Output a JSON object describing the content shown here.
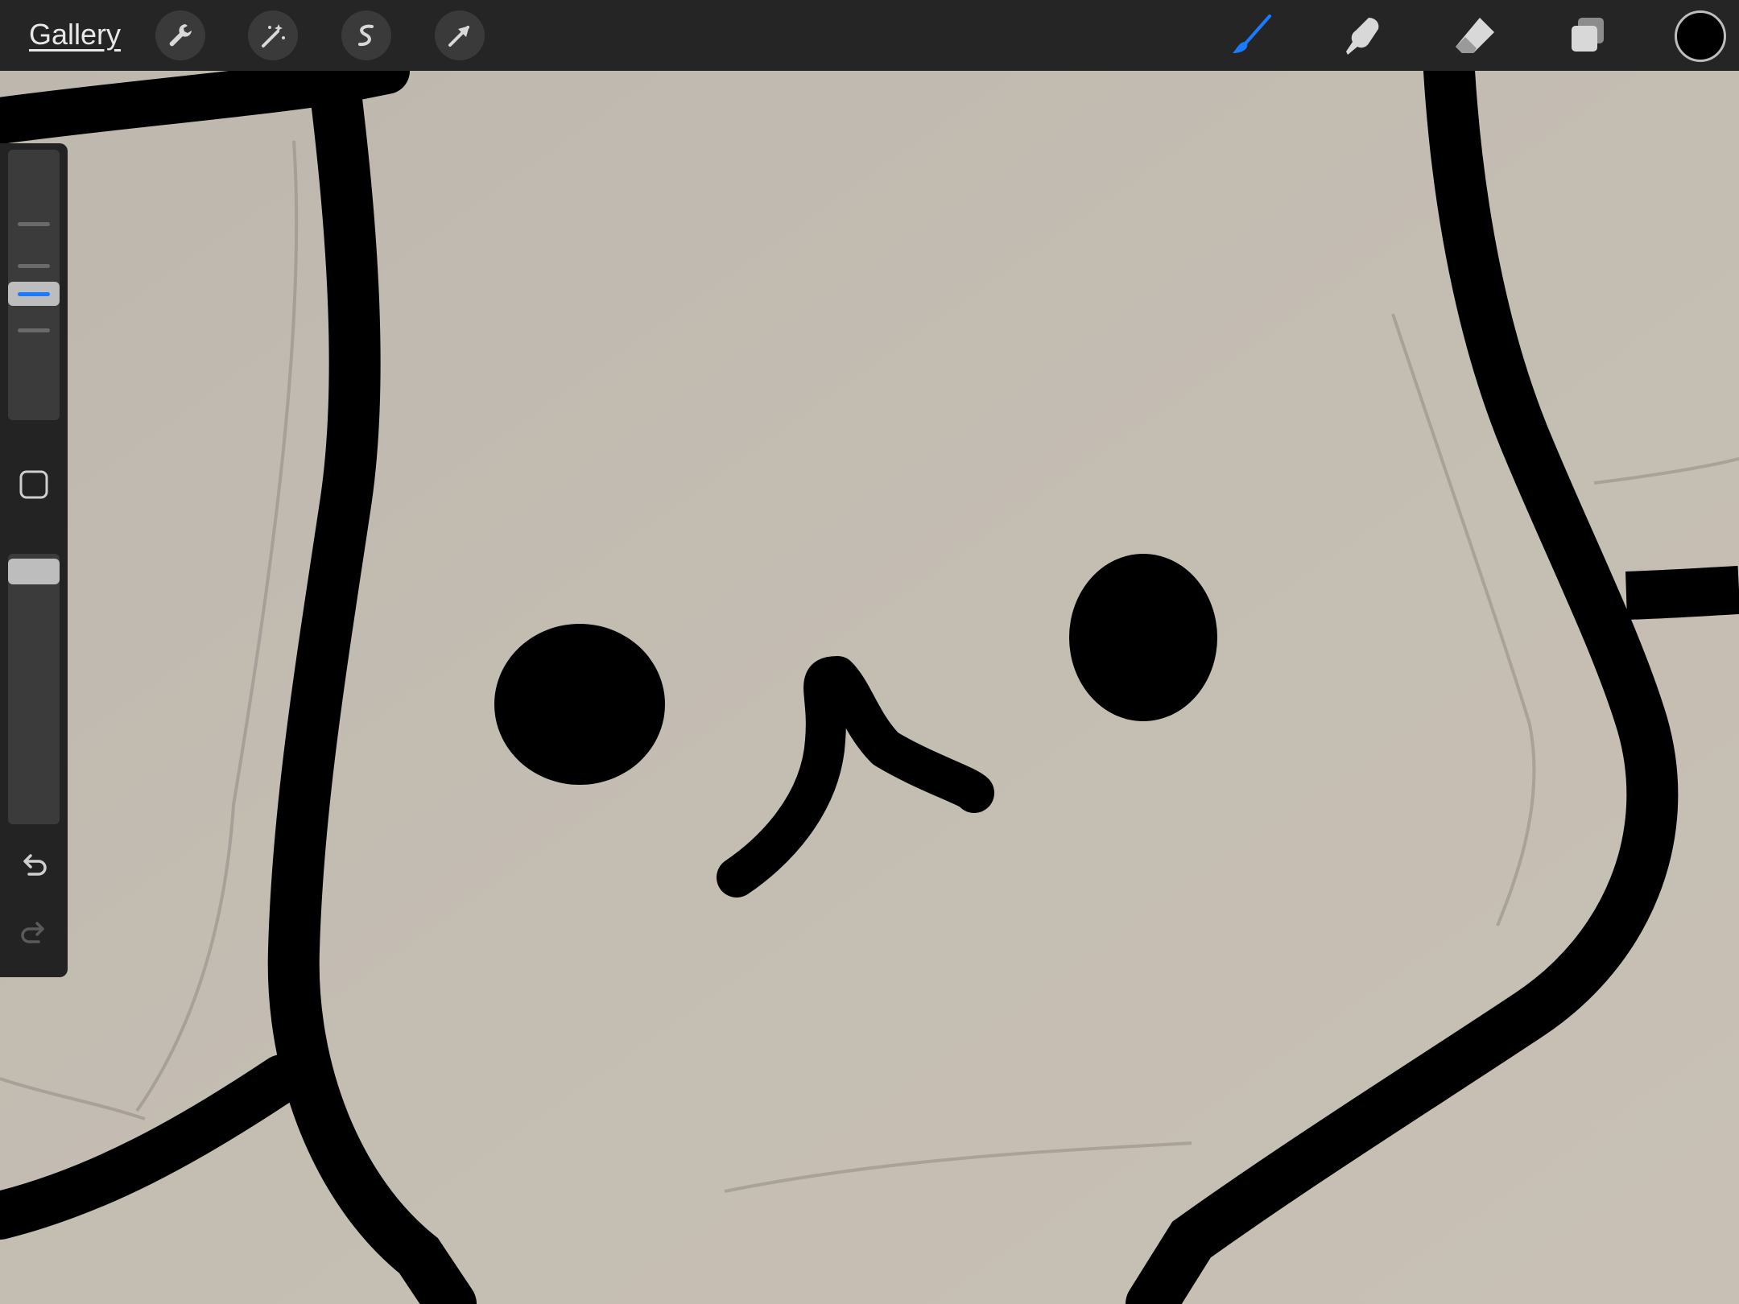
{
  "topbar": {
    "gallery_label": "Gallery",
    "left_tools": [
      {
        "name": "actions",
        "icon": "wrench-icon"
      },
      {
        "name": "adjustments",
        "icon": "magic-wand-icon"
      },
      {
        "name": "selection",
        "icon": "selection-s-icon"
      },
      {
        "name": "transform",
        "icon": "arrow-cursor-icon"
      }
    ],
    "right_tools": [
      {
        "name": "brush",
        "icon": "paintbrush-icon",
        "active": true
      },
      {
        "name": "smudge",
        "icon": "smudge-finger-icon",
        "active": false
      },
      {
        "name": "eraser",
        "icon": "eraser-icon",
        "active": false
      },
      {
        "name": "layers",
        "icon": "layers-icon",
        "active": false
      }
    ],
    "current_color": "#000000"
  },
  "sidebar": {
    "brush_size_level": 0.3,
    "opacity_level": 1.0,
    "icons": [
      "modify-square-icon",
      "undo-icon",
      "redo-icon"
    ]
  },
  "colors": {
    "accent": "#1a7bff",
    "toolbar": "#252525",
    "canvas_paper": "#c3bcb2"
  }
}
